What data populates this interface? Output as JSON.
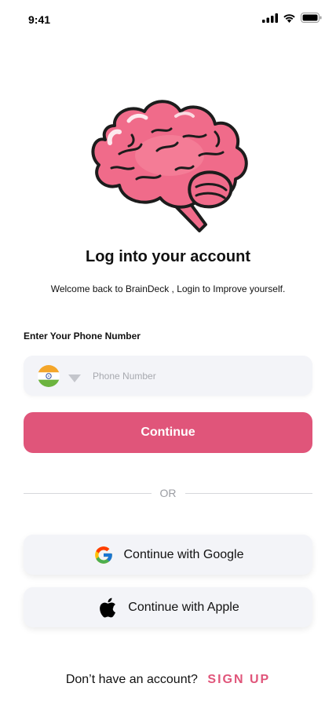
{
  "status_bar": {
    "time": "9:41",
    "icons": [
      "signal-icon",
      "wifi-icon",
      "battery-icon"
    ]
  },
  "hero": {
    "illustration": "brain-icon",
    "color": "#f06b8a"
  },
  "header": {
    "title": "Log into your account",
    "subtitle": "Welcome back to BrainDeck , Login to Improve yourself."
  },
  "phone": {
    "label": "Enter Your Phone Number",
    "country_flag": "india-flag-icon",
    "placeholder": "Phone Number",
    "value": ""
  },
  "continue_button": {
    "label": "Continue",
    "color": "#e0557a"
  },
  "divider": {
    "label": "OR"
  },
  "social": {
    "google_label": "Continue with Google",
    "apple_label": "Continue with Apple"
  },
  "footer": {
    "prompt": "Don’t have an account?",
    "signup_label": "SIGN UP"
  }
}
